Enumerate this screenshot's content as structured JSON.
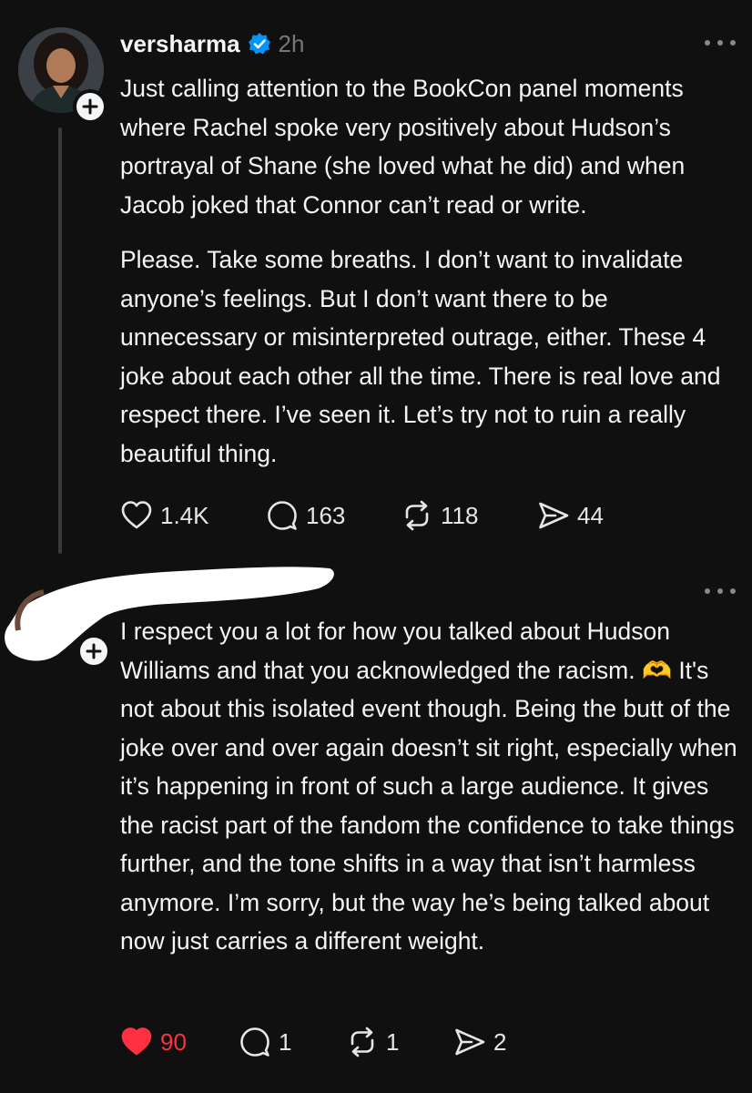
{
  "posts": [
    {
      "username": "versharma",
      "verified": true,
      "timestamp": "2h",
      "paragraphs": [
        "Just calling attention to the BookCon panel moments where Rachel spoke very positively about Hudson’s portrayal of Shane (she loved what he did) and when Jacob joked that Connor can’t read or write.",
        "Please. Take some breaths. I don’t want to invalidate anyone’s feelings. But I don’t want there to be unnecessary or misinterpreted outrage, either. These 4 joke about each other all the time. There is real love and respect there. I’ve seen it. Let’s try not to ruin a really beautiful thing."
      ],
      "likes": "1.4K",
      "replies": "163",
      "reposts": "118",
      "shares": "44",
      "liked": false
    },
    {
      "username_redacted": true,
      "text": "I respect you a lot for how you talked about Hudson Williams and that you acknowledged the racism. 🫶 It's not about this isolated event though. Being the butt of the joke over and over again doesn’t sit right, especially when it’s happening in front of such a large audience. It gives the racist part of the fandom the confidence to take things further, and the tone shifts in a way that isn’t harmless anymore. I’m sorry, but the way he’s being talked about now just carries a different weight.",
      "likes": "90",
      "replies": "1",
      "reposts": "1",
      "shares": "2",
      "liked": true
    }
  ],
  "colors": {
    "background": "#101010",
    "text": "#f3f5f7",
    "muted": "#777777",
    "verified": "#0095f6",
    "like_active": "#ff3040"
  },
  "icons": [
    "heart-icon",
    "comment-icon",
    "repost-icon",
    "share-icon",
    "verified-badge-icon",
    "more-icon",
    "plus-icon"
  ]
}
